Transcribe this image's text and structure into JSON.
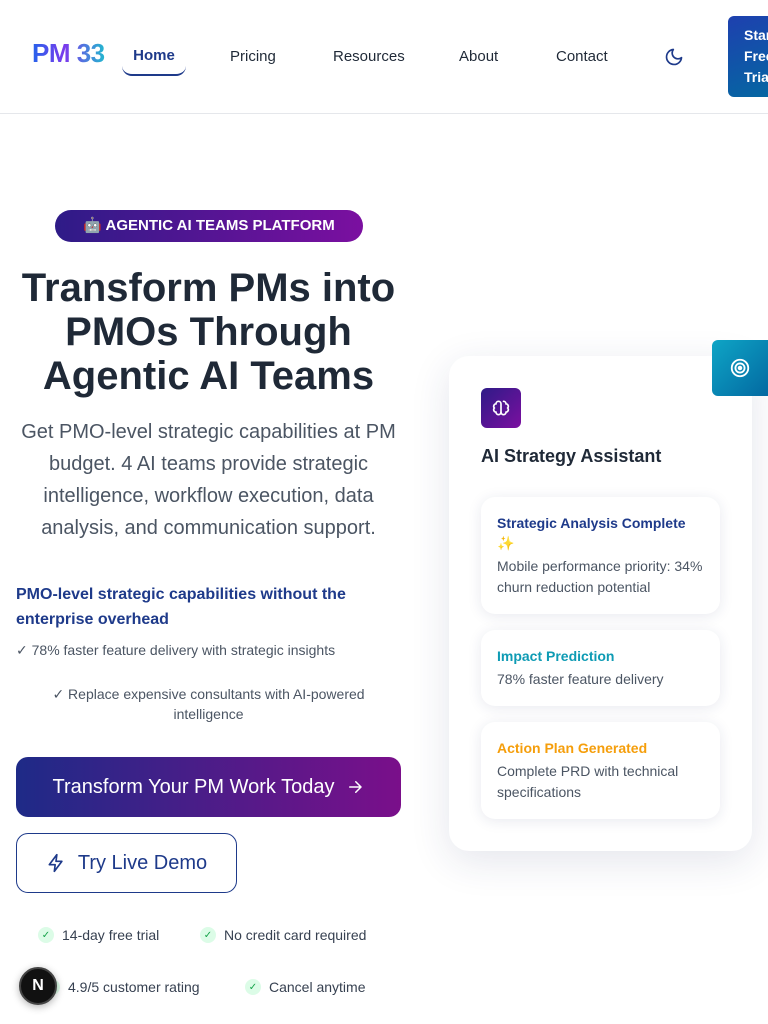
{
  "nav": {
    "logo": "PM 33",
    "links": [
      "Home",
      "Pricing",
      "Resources",
      "About",
      "Contact"
    ],
    "cta_lines": [
      "Start",
      "Free",
      "Trial"
    ]
  },
  "hero": {
    "badge": "🤖 AGENTIC AI TEAMS PLATFORM",
    "title": "Transform PMs into PMOs Through Agentic AI Teams",
    "subtitle": "Get PMO-level strategic capabilities at PM budget. 4 AI teams provide strategic intelligence, workflow execution, data analysis, and communication support.",
    "tagline": "PMO-level strategic capabilities without the enterprise overhead",
    "bullet1": "✓ 78% faster feature delivery with strategic insights",
    "bullet2": "✓ Replace expensive consultants with AI-powered intelligence",
    "primary_cta": "Transform Your PM Work Today",
    "secondary_cta": "Try Live Demo",
    "perks": [
      "14-day free trial",
      "No credit card required",
      "4.9/5 customer rating",
      "Cancel anytime"
    ]
  },
  "card": {
    "title": "AI Strategy Assistant",
    "items": [
      {
        "heading": "Strategic Analysis Complete ✨",
        "body": "Mobile performance priority: 34% churn reduction potential",
        "color": "#1e3a8a"
      },
      {
        "heading": "Impact Prediction",
        "body": "78% faster feature delivery",
        "color": "#0e9bb4"
      },
      {
        "heading": "Action Plan Generated",
        "body": "Complete PRD with technical specifications",
        "color": "#f59e0b"
      }
    ]
  },
  "dev_badge": "N",
  "colors": {
    "brand_navy": "#1e3a8a",
    "gradient_start": "#2e1b87",
    "gradient_end": "#7b0fa0",
    "teal": "#0e9bb4",
    "amber": "#f59e0b"
  }
}
